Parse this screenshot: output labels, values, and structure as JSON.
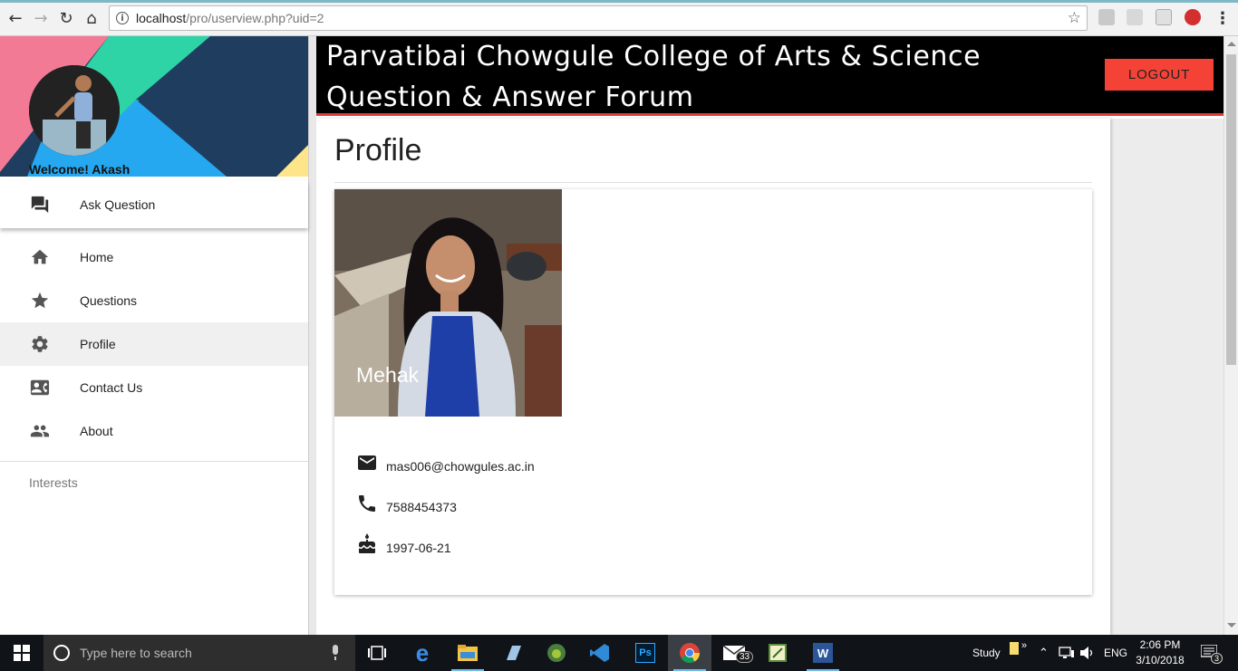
{
  "browser": {
    "url_host": "localhost",
    "url_path": "/pro/userview.php?uid=2"
  },
  "sidebar": {
    "welcome": "Welcome! Akash",
    "ask_question": "Ask Question",
    "items": [
      {
        "label": "Home",
        "icon": "home-icon"
      },
      {
        "label": "Questions",
        "icon": "star-icon"
      },
      {
        "label": "Profile",
        "icon": "gear-icon",
        "active": true
      },
      {
        "label": "Contact Us",
        "icon": "contact-card-icon"
      },
      {
        "label": "About",
        "icon": "people-icon"
      }
    ],
    "interests_label": "Interests"
  },
  "header": {
    "title_line1": "Parvatibai Chowgule College of Arts & Science",
    "title_line2": "Question & Answer Forum",
    "logout_label": "LOGOUT"
  },
  "profile": {
    "page_title": "Profile",
    "name": "Mehak",
    "email": "mas006@chowgules.ac.in",
    "phone": "7588454373",
    "birthdate": "1997-06-21"
  },
  "taskbar": {
    "search_placeholder": "Type here to search",
    "mail_badge": "33",
    "study_label": "Study",
    "language": "ENG",
    "time": "2:06 PM",
    "date": "3/10/2018",
    "notification_count": "3"
  },
  "colors": {
    "header_bg": "#000000",
    "header_underline": "#e53935",
    "logout_bg": "#f44336"
  }
}
